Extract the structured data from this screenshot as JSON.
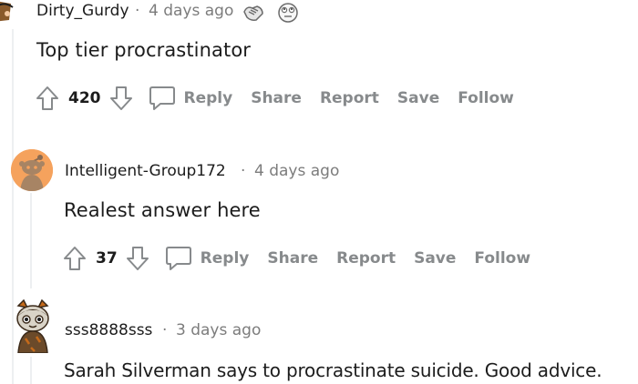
{
  "comments": [
    {
      "username": "Dirty_Gurdy",
      "separator": "·",
      "time": "4 days ago",
      "body": "Top tier procrastinator",
      "score": "420",
      "actions": {
        "reply": "Reply",
        "share": "Share",
        "report": "Report",
        "save": "Save",
        "follow": "Follow"
      },
      "awards": [
        "handshake-award-icon",
        "rolling-eyes-award-icon"
      ]
    },
    {
      "username": "Intelligent-Group172",
      "separator": "·",
      "time": "4 days ago",
      "body": "Realest answer here",
      "score": "37",
      "actions": {
        "reply": "Reply",
        "share": "Share",
        "report": "Report",
        "save": "Save",
        "follow": "Follow"
      },
      "avatar_color": "#f5a25d"
    },
    {
      "username": "sss8888sss",
      "separator": "·",
      "time": "3 days ago",
      "body": "Sarah Silverman says to procrastinate suicide. Good advice."
    }
  ],
  "colors": {
    "action_gray": "#878a8c",
    "meta_gray": "#7c7c7c",
    "thread_line": "#edeff1",
    "avatar_orange": "#f5a25d"
  }
}
